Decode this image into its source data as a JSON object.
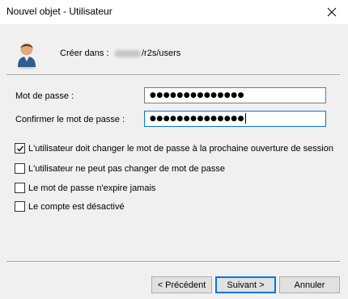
{
  "window": {
    "title": "Nouvel objet - Utilisateur"
  },
  "header": {
    "create_label": "Créer dans :",
    "create_path": "/r2s/users"
  },
  "fields": {
    "password_label": "Mot de passe :",
    "password_value": "●●●●●●●●●●●●●●",
    "confirm_label": "Confirmer le mot de passe :",
    "confirm_value": "●●●●●●●●●●●●●●"
  },
  "options": [
    {
      "label": "L'utilisateur doit changer le mot de passe à la prochaine ouverture de session",
      "checked": true
    },
    {
      "label": "L'utilisateur ne peut pas changer de mot de passe",
      "checked": false
    },
    {
      "label": "Le mot de passe n'expire jamais",
      "checked": false
    },
    {
      "label": "Le compte est désactivé",
      "checked": false
    }
  ],
  "buttons": {
    "back": "< Précédent",
    "next": "Suivant >",
    "cancel": "Annuler"
  },
  "colors": {
    "accent": "#0078d7",
    "background": "#f0f0f0"
  }
}
